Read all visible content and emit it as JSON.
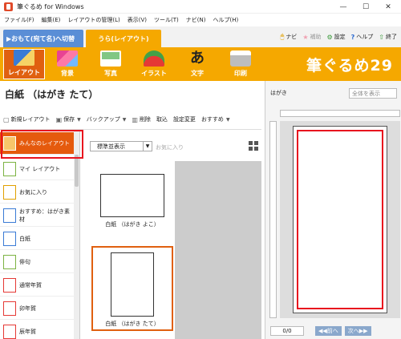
{
  "window": {
    "title": "筆ぐるめ for Windows",
    "controls": [
      "—",
      "☐",
      "✕"
    ]
  },
  "menu": [
    "ファイル(F)",
    "編集(E)",
    "レイアウトの管理(L)",
    "表示(V)",
    "ツール(T)",
    "ナビ(N)",
    "ヘルプ(H)"
  ],
  "modes": {
    "omote": "▶おもて(宛て名)へ切替",
    "ura": "うら(レイアウト)"
  },
  "helpers": [
    {
      "icon": "🖱",
      "label": "ナビ"
    },
    {
      "icon": "★",
      "label": "補助"
    },
    {
      "icon": "⚙",
      "label": "設定"
    },
    {
      "icon": "?",
      "label": "ヘルプ"
    },
    {
      "icon": "⇧",
      "label": "終了"
    }
  ],
  "ribbon": [
    "レイアウト",
    "背景",
    "写真",
    "イラスト",
    "文字",
    "印刷"
  ],
  "logo": "筆ぐるめ29",
  "page_title": "白紙 （はがき たて）",
  "toolbar": [
    "新規レイアウト",
    "保存",
    "バックアップ",
    "削除",
    "取込",
    "設定変更",
    "おすすめ"
  ],
  "sidebar": [
    "みんなのレイアウト",
    "マイ レイアウト",
    "お気に入り",
    "おすすめ：はがき素材",
    "白紙",
    "俳句",
    "通常年賀",
    "卯年賀",
    "辰年賀"
  ],
  "sort": {
    "value": "標準並表示",
    "fav": "お気に入り"
  },
  "thumbs": [
    "白紙 （はがき よこ）",
    "白紙 （はがき たて）"
  ],
  "preview": {
    "label": "はがき",
    "select": "全体を表示",
    "pager": "0/0",
    "prev": "◀◀前へ",
    "next": "次へ▶▶"
  }
}
